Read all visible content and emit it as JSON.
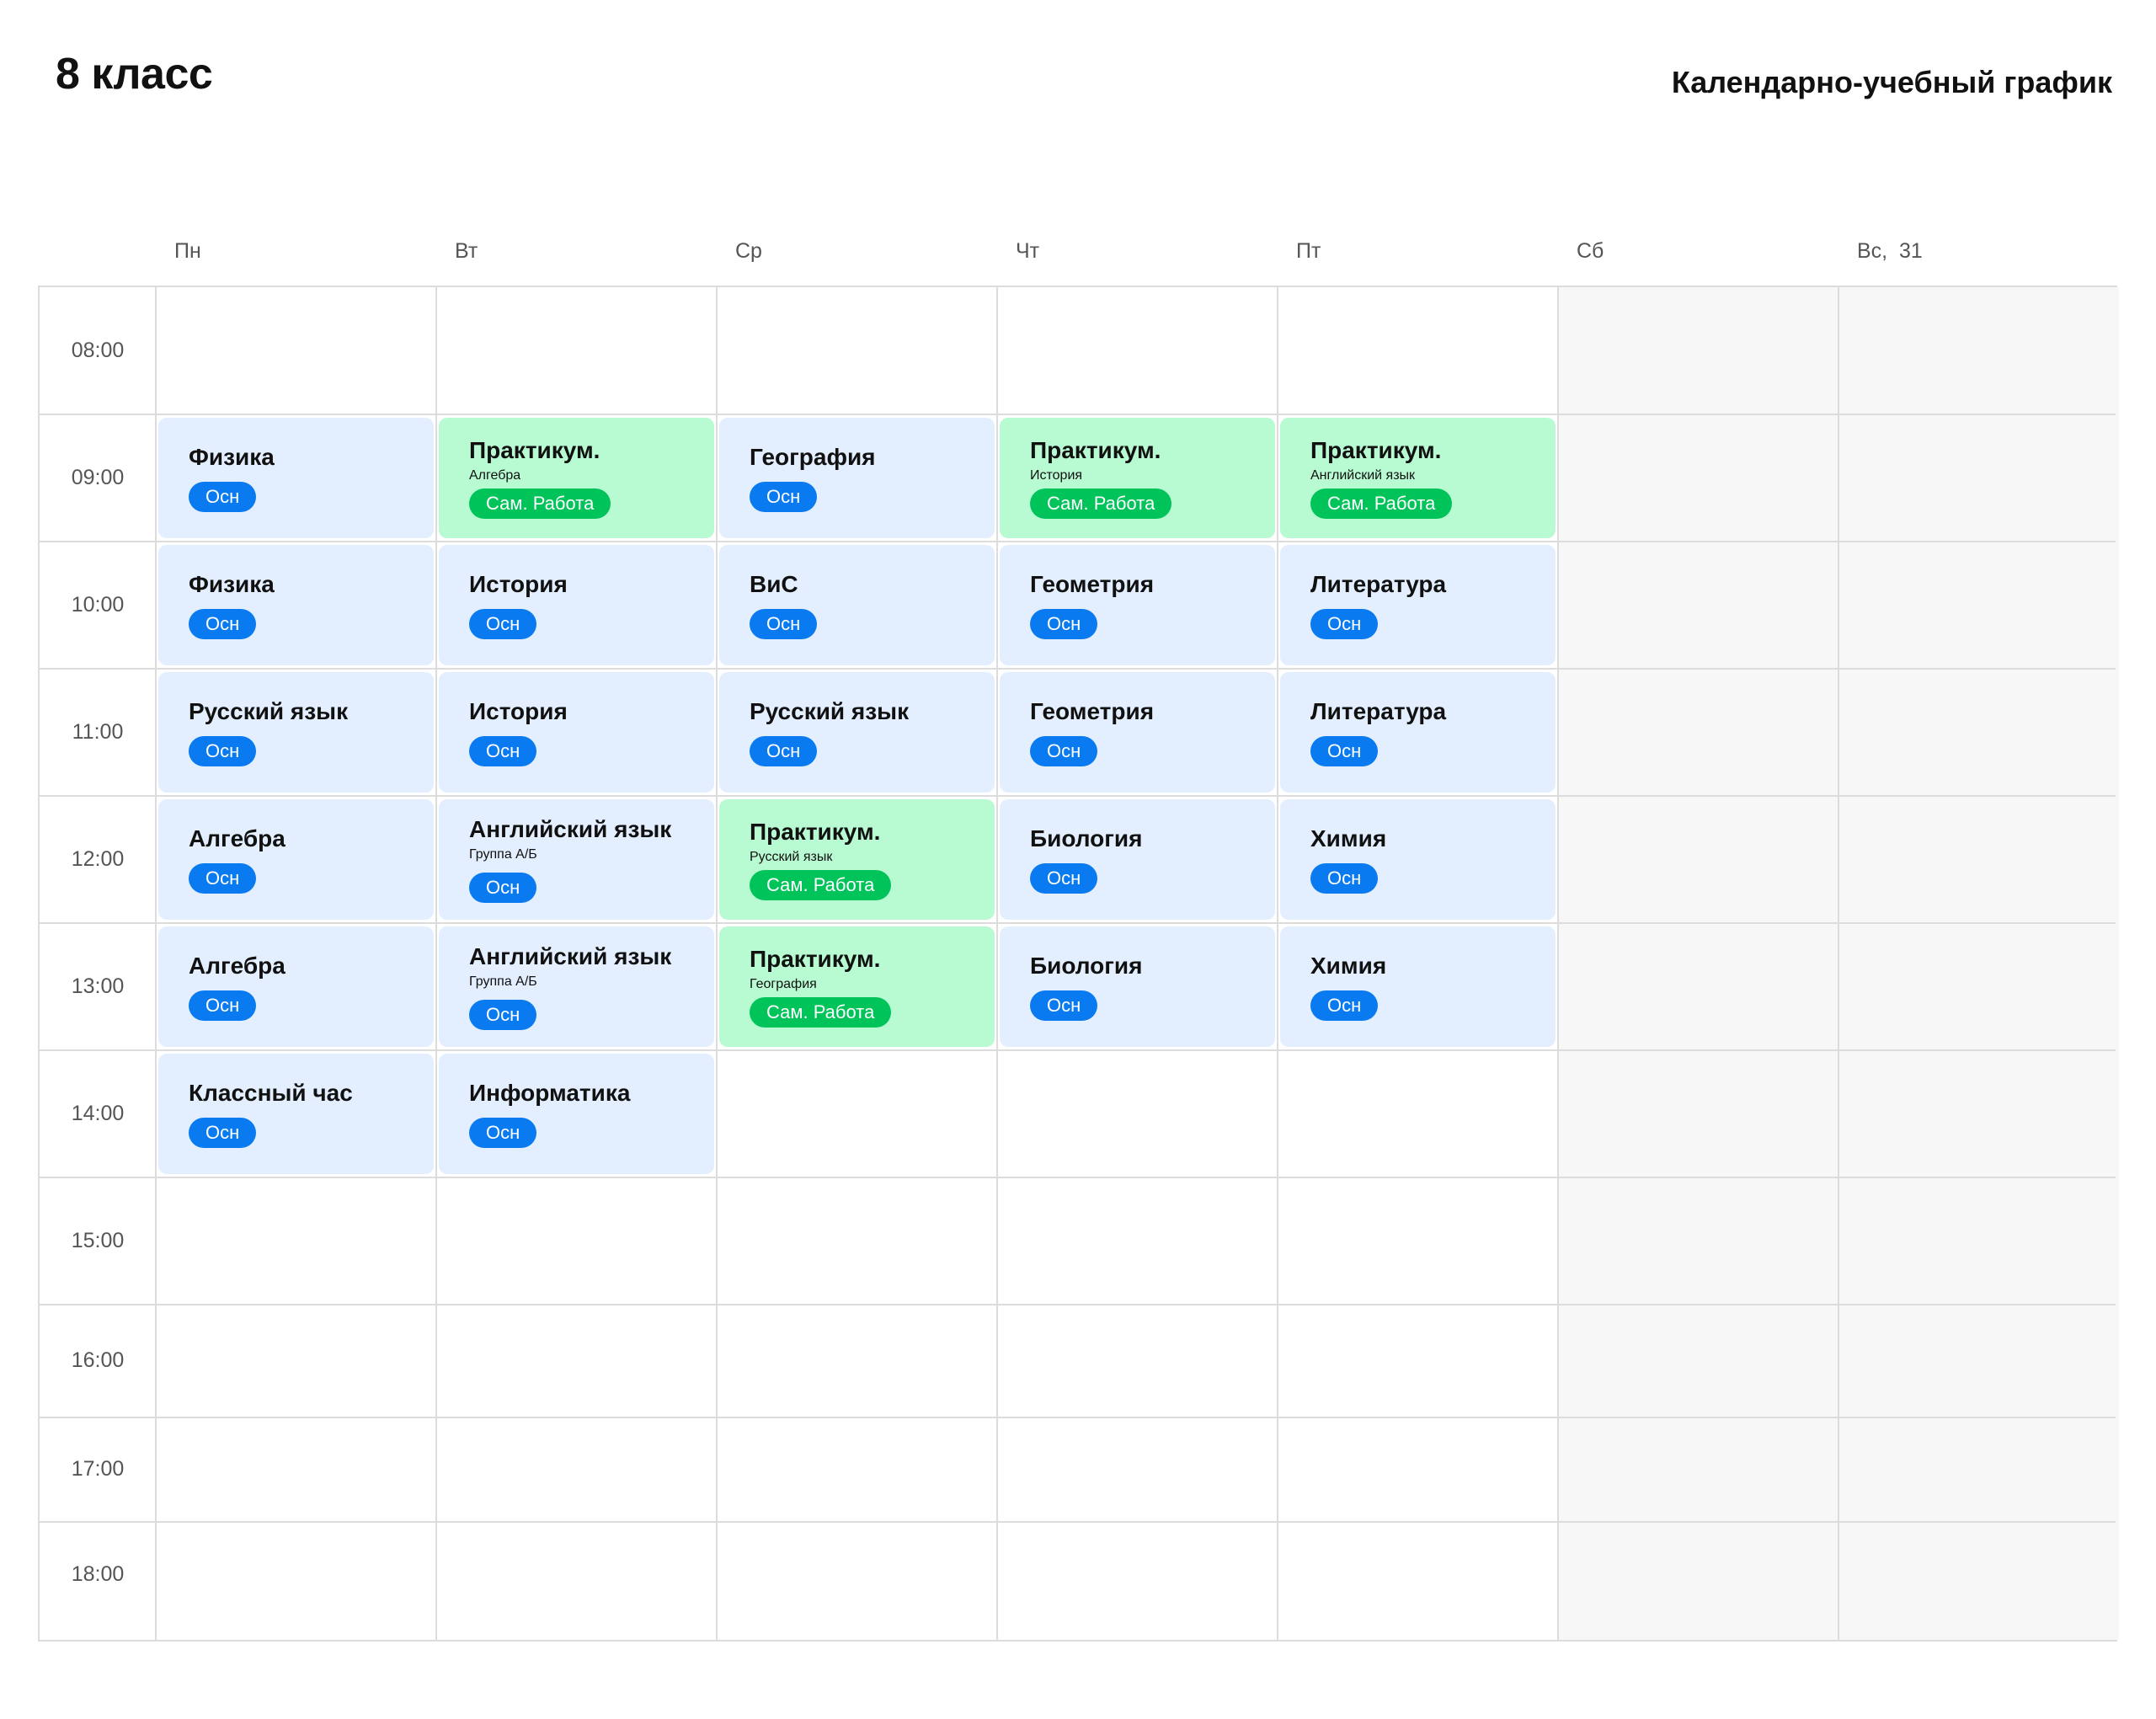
{
  "header": {
    "title": "8 класс",
    "subtitle": "Календарно-учебный график"
  },
  "days": [
    "Пн",
    "Вт",
    "Ср",
    "Чт",
    "Пт",
    "Сб",
    "Вс,  31"
  ],
  "times": [
    "08:00",
    "09:00",
    "10:00",
    "11:00",
    "12:00",
    "13:00",
    "14:00",
    "15:00",
    "16:00",
    "17:00",
    "18:00"
  ],
  "colors": {
    "main_card": "#e3efff",
    "practice_card": "#b8fbd2",
    "main_badge": "#0a7af0",
    "practice_badge": "#00c45a",
    "weekend_bg": "#f7f7f7",
    "grid_line": "#dcdcdc"
  },
  "lessons": [
    {
      "day": 0,
      "slot": 1,
      "kind": "main",
      "title": "Физика",
      "badge": "Осн"
    },
    {
      "day": 0,
      "slot": 2,
      "kind": "main",
      "title": "Физика",
      "badge": "Осн"
    },
    {
      "day": 0,
      "slot": 3,
      "kind": "main",
      "title": "Русский язык",
      "badge": "Осн"
    },
    {
      "day": 0,
      "slot": 4,
      "kind": "main",
      "title": "Алгебра",
      "badge": "Осн"
    },
    {
      "day": 0,
      "slot": 5,
      "kind": "main",
      "title": "Алгебра",
      "badge": "Осн"
    },
    {
      "day": 0,
      "slot": 6,
      "kind": "main",
      "title": "Классный час",
      "badge": "Осн"
    },
    {
      "day": 1,
      "slot": 1,
      "kind": "practice",
      "title": "Практикум.",
      "sub": "Алгебра",
      "badge": "Сам. Работа"
    },
    {
      "day": 1,
      "slot": 2,
      "kind": "main",
      "title": "История",
      "badge": "Осн"
    },
    {
      "day": 1,
      "slot": 3,
      "kind": "main",
      "title": "История",
      "badge": "Осн"
    },
    {
      "day": 1,
      "slot": 4,
      "kind": "main",
      "title": "Английский язык",
      "sub": "Группа А/Б",
      "badge": "Осн"
    },
    {
      "day": 1,
      "slot": 5,
      "kind": "main",
      "title": "Английский язык",
      "sub": "Группа А/Б",
      "badge": "Осн"
    },
    {
      "day": 1,
      "slot": 6,
      "kind": "main",
      "title": "Информатика",
      "badge": "Осн"
    },
    {
      "day": 2,
      "slot": 1,
      "kind": "main",
      "title": "География",
      "badge": "Осн"
    },
    {
      "day": 2,
      "slot": 2,
      "kind": "main",
      "title": "ВиС",
      "badge": "Осн"
    },
    {
      "day": 2,
      "slot": 3,
      "kind": "main",
      "title": "Русский язык",
      "badge": "Осн"
    },
    {
      "day": 2,
      "slot": 4,
      "kind": "practice",
      "title": "Практикум.",
      "sub": "Русский язык",
      "badge": "Сам. Работа"
    },
    {
      "day": 2,
      "slot": 5,
      "kind": "practice",
      "title": "Практикум.",
      "sub": "География",
      "badge": "Сам. Работа"
    },
    {
      "day": 3,
      "slot": 1,
      "kind": "practice",
      "title": "Практикум.",
      "sub": "История",
      "badge": "Сам. Работа"
    },
    {
      "day": 3,
      "slot": 2,
      "kind": "main",
      "title": "Геометрия",
      "badge": "Осн"
    },
    {
      "day": 3,
      "slot": 3,
      "kind": "main",
      "title": "Геометрия",
      "badge": "Осн"
    },
    {
      "day": 3,
      "slot": 4,
      "kind": "main",
      "title": "Биология",
      "badge": "Осн"
    },
    {
      "day": 3,
      "slot": 5,
      "kind": "main",
      "title": "Биология",
      "badge": "Осн"
    },
    {
      "day": 4,
      "slot": 1,
      "kind": "practice",
      "title": "Практикум.",
      "sub": "Английский язык",
      "badge": "Сам. Работа"
    },
    {
      "day": 4,
      "slot": 2,
      "kind": "main",
      "title": "Литература",
      "badge": "Осн"
    },
    {
      "day": 4,
      "slot": 3,
      "kind": "main",
      "title": "Литература",
      "badge": "Осн"
    },
    {
      "day": 4,
      "slot": 4,
      "kind": "main",
      "title": "Химия",
      "badge": "Осн"
    },
    {
      "day": 4,
      "slot": 5,
      "kind": "main",
      "title": "Химия",
      "badge": "Осн"
    }
  ]
}
